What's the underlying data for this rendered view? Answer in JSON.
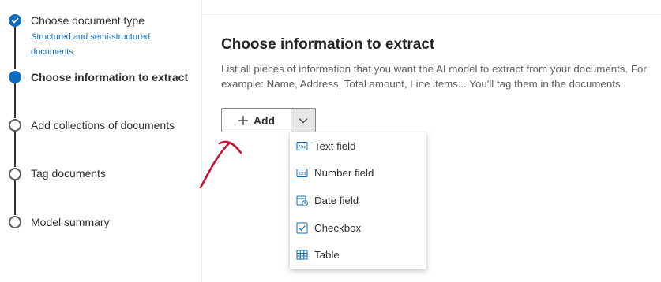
{
  "stepper": {
    "steps": [
      {
        "label": "Choose document type",
        "sublabel": "Structured and semi-structured documents",
        "state": "done"
      },
      {
        "label": "Choose information to extract",
        "state": "current"
      },
      {
        "label": "Add collections of documents",
        "state": "todo"
      },
      {
        "label": "Tag documents",
        "state": "todo"
      },
      {
        "label": "Model summary",
        "state": "todo"
      }
    ]
  },
  "main": {
    "title": "Choose information to extract",
    "description_line1": "List all pieces of information that you want the AI model to extract from your documents. For",
    "description_line2": "example: Name, Address, Total amount, Line items... You'll tag them in the documents.",
    "add_button_label": "Add"
  },
  "menu": {
    "items": [
      {
        "label": "Text field",
        "icon": "text-field-icon"
      },
      {
        "label": "Number field",
        "icon": "number-field-icon"
      },
      {
        "label": "Date field",
        "icon": "date-field-icon"
      },
      {
        "label": "Checkbox",
        "icon": "checkbox-icon"
      },
      {
        "label": "Table",
        "icon": "table-icon"
      }
    ]
  },
  "colors": {
    "accent": "#0f6cbd",
    "annotation_arrow": "#c8102e"
  }
}
